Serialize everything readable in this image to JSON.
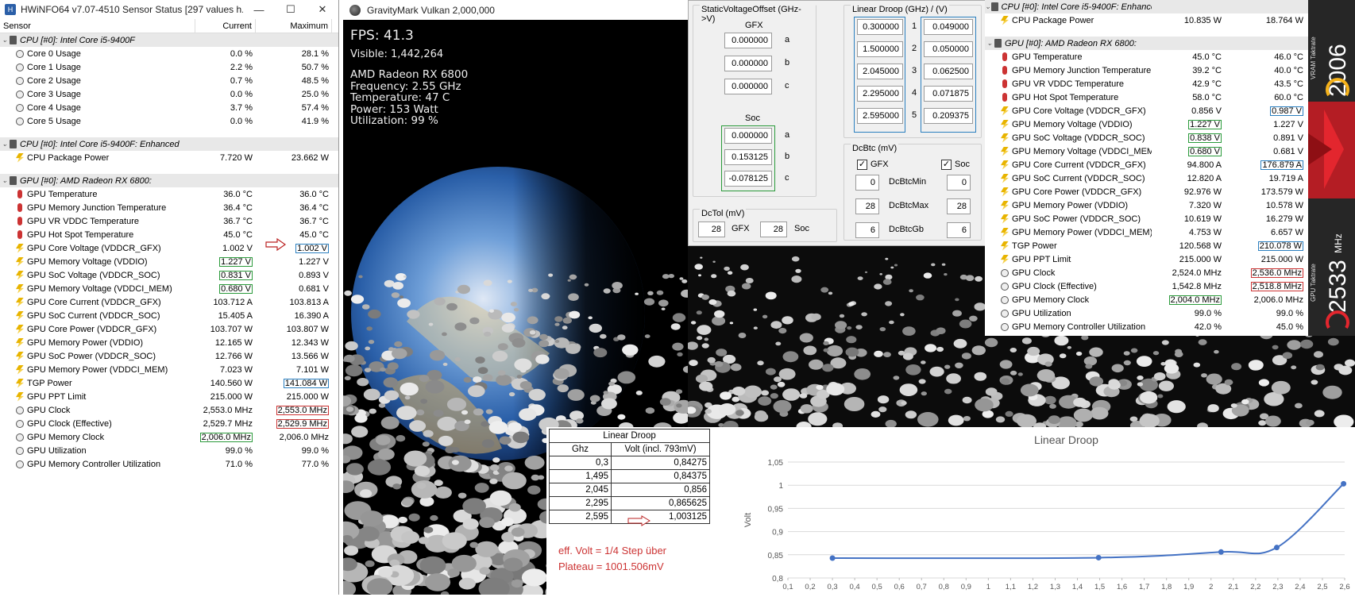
{
  "hwinfo_left": {
    "title": "HWiNFO64 v7.07-4510 Sensor Status [297 values h...",
    "win_buttons": [
      "—",
      "☐",
      "✕"
    ],
    "columns": [
      "Sensor",
      "Current",
      "Maximum"
    ],
    "groups": [
      {
        "title": "CPU [#0]: Intel Core i5-9400F",
        "rows": [
          {
            "icon": "clock",
            "name": "Core 0 Usage",
            "current": "0.0 %",
            "max": "28.1 %"
          },
          {
            "icon": "clock",
            "name": "Core 1 Usage",
            "current": "2.2 %",
            "max": "50.7 %"
          },
          {
            "icon": "clock",
            "name": "Core 2 Usage",
            "current": "0.7 %",
            "max": "48.5 %"
          },
          {
            "icon": "clock",
            "name": "Core 3 Usage",
            "current": "0.0 %",
            "max": "25.0 %"
          },
          {
            "icon": "clock",
            "name": "Core 4 Usage",
            "current": "3.7 %",
            "max": "57.4 %"
          },
          {
            "icon": "clock",
            "name": "Core 5 Usage",
            "current": "0.0 %",
            "max": "41.9 %"
          }
        ]
      },
      {
        "title": "CPU [#0]: Intel Core i5-9400F: Enhanced",
        "rows": [
          {
            "icon": "bolt",
            "name": "CPU Package Power",
            "current": "7.720 W",
            "max": "23.662 W"
          }
        ]
      },
      {
        "title": "GPU [#0]: AMD Radeon RX 6800:",
        "rows": [
          {
            "icon": "therm",
            "name": "GPU Temperature",
            "current": "36.0 °C",
            "max": "36.0 °C"
          },
          {
            "icon": "therm",
            "name": "GPU Memory Junction Temperature",
            "current": "36.4 °C",
            "max": "36.4 °C"
          },
          {
            "icon": "therm",
            "name": "GPU VR VDDC Temperature",
            "current": "36.7 °C",
            "max": "36.7 °C"
          },
          {
            "icon": "therm",
            "name": "GPU Hot Spot Temperature",
            "current": "45.0 °C",
            "max": "45.0 °C"
          },
          {
            "icon": "bolt",
            "name": "GPU Core Voltage (VDDCR_GFX)",
            "current": "1.002 V",
            "max": "1.002 V",
            "box_max": "blue",
            "arrow": true
          },
          {
            "icon": "bolt",
            "name": "GPU Memory Voltage (VDDIO)",
            "current": "1.227 V",
            "max": "1.227 V",
            "box_cur": "green"
          },
          {
            "icon": "bolt",
            "name": "GPU SoC Voltage (VDDCR_SOC)",
            "current": "0.831 V",
            "max": "0.893 V",
            "box_cur": "green"
          },
          {
            "icon": "bolt",
            "name": "GPU Memory Voltage (VDDCI_MEM)",
            "current": "0.680 V",
            "max": "0.681 V",
            "box_cur": "green"
          },
          {
            "icon": "bolt",
            "name": "GPU Core Current (VDDCR_GFX)",
            "current": "103.712 A",
            "max": "103.813 A"
          },
          {
            "icon": "bolt",
            "name": "GPU SoC Current (VDDCR_SOC)",
            "current": "15.405 A",
            "max": "16.390 A"
          },
          {
            "icon": "bolt",
            "name": "GPU Core Power (VDDCR_GFX)",
            "current": "103.707 W",
            "max": "103.807 W"
          },
          {
            "icon": "bolt",
            "name": "GPU Memory Power (VDDIO)",
            "current": "12.165 W",
            "max": "12.343 W"
          },
          {
            "icon": "bolt",
            "name": "GPU SoC Power (VDDCR_SOC)",
            "current": "12.766 W",
            "max": "13.566 W"
          },
          {
            "icon": "bolt",
            "name": "GPU Memory Power (VDDCI_MEM)",
            "current": "7.023 W",
            "max": "7.101 W"
          },
          {
            "icon": "bolt",
            "name": "TGP Power",
            "current": "140.560 W",
            "max": "141.084 W",
            "box_max": "blue"
          },
          {
            "icon": "bolt",
            "name": "GPU PPT Limit",
            "current": "215.000 W",
            "max": "215.000 W"
          },
          {
            "icon": "clock",
            "name": "GPU Clock",
            "current": "2,553.0 MHz",
            "max": "2,553.0 MHz",
            "box_max": "red"
          },
          {
            "icon": "clock",
            "name": "GPU Clock (Effective)",
            "current": "2,529.7 MHz",
            "max": "2,529.9 MHz",
            "box_max": "red"
          },
          {
            "icon": "clock",
            "name": "GPU Memory Clock",
            "current": "2,006.0 MHz",
            "max": "2,006.0 MHz",
            "box_cur": "green"
          },
          {
            "icon": "clock",
            "name": "GPU Utilization",
            "current": "99.0 %",
            "max": "99.0 %"
          },
          {
            "icon": "clock",
            "name": "GPU Memory Controller Utilization",
            "current": "71.0 %",
            "max": "77.0 %"
          }
        ]
      }
    ]
  },
  "gravitymark": {
    "title": "GravityMark Vulkan 2,000,000",
    "fps": "FPS: 41.3",
    "visible": "Visible: 1,442,264",
    "gpu": "AMD Radeon RX 6800",
    "frequency": "Frequency: 2.55 GHz",
    "temperature": "Temperature: 47 C",
    "power": "Power: 153 Watt",
    "utilization": "Utilization: 99 %"
  },
  "voltage_editor": {
    "static_offset_label": "StaticVoltageOffset (GHz->V)",
    "gfx_label": "GFX",
    "gfx": [
      {
        "v": "0.000000",
        "k": "a"
      },
      {
        "v": "0.000000",
        "k": "b"
      },
      {
        "v": "0.000000",
        "k": "c"
      }
    ],
    "soc_label": "Soc",
    "soc": [
      {
        "v": "0.000000",
        "k": "a"
      },
      {
        "v": "0.153125",
        "k": "b"
      },
      {
        "v": "-0.078125",
        "k": "c"
      }
    ],
    "linear_droop_label": "Linear Droop (GHz) / (V)",
    "droop": [
      {
        "ghz": "0.300000",
        "n": "1",
        "v": "0.049000"
      },
      {
        "ghz": "1.500000",
        "n": "2",
        "v": "0.050000"
      },
      {
        "ghz": "2.045000",
        "n": "3",
        "v": "0.062500"
      },
      {
        "ghz": "2.295000",
        "n": "4",
        "v": "0.071875"
      },
      {
        "ghz": "2.595000",
        "n": "5",
        "v": "0.209375"
      }
    ],
    "dcbtc_label": "DcBtc (mV)",
    "dcbtc_gfx": "GFX",
    "dcbtc_soc": "Soc",
    "dcbtc_rows": [
      {
        "l": "0",
        "name": "DcBtcMin",
        "r": "0"
      },
      {
        "l": "28",
        "name": "DcBtcMax",
        "r": "28"
      },
      {
        "l": "6",
        "name": "DcBtcGb",
        "r": "6"
      }
    ],
    "dctol_label": "DcTol (mV)",
    "dctol_gfx_val": "28",
    "dctol_gfx": "GFX",
    "dctol_soc_val": "28",
    "dctol_soc": "Soc"
  },
  "hwinfo_right": {
    "groups": [
      {
        "title": "CPU [#0]: Intel Core i5-9400F: Enhanced",
        "rows": [
          {
            "icon": "bolt",
            "name": "CPU Package Power",
            "current": "10.835 W",
            "max": "18.764 W"
          }
        ]
      },
      {
        "title": "GPU [#0]: AMD Radeon RX 6800:",
        "rows": [
          {
            "icon": "therm",
            "name": "GPU Temperature",
            "current": "45.0 °C",
            "max": "46.0 °C"
          },
          {
            "icon": "therm",
            "name": "GPU Memory Junction Temperature",
            "current": "39.2 °C",
            "max": "40.0 °C"
          },
          {
            "icon": "therm",
            "name": "GPU VR VDDC Temperature",
            "current": "42.9 °C",
            "max": "43.5 °C"
          },
          {
            "icon": "therm",
            "name": "GPU Hot Spot Temperature",
            "current": "58.0 °C",
            "max": "60.0 °C"
          },
          {
            "icon": "bolt",
            "name": "GPU Core Voltage (VDDCR_GFX)",
            "current": "0.856 V",
            "max": "0.987 V",
            "box_max": "blue"
          },
          {
            "icon": "bolt",
            "name": "GPU Memory Voltage (VDDIO)",
            "current": "1.227 V",
            "max": "1.227 V",
            "box_cur": "green"
          },
          {
            "icon": "bolt",
            "name": "GPU SoC Voltage (VDDCR_SOC)",
            "current": "0.838 V",
            "max": "0.891 V",
            "box_cur": "green"
          },
          {
            "icon": "bolt",
            "name": "GPU Memory Voltage (VDDCI_MEM)",
            "current": "0.680 V",
            "max": "0.681 V",
            "box_cur": "green"
          },
          {
            "icon": "bolt",
            "name": "GPU Core Current (VDDCR_GFX)",
            "current": "94.800 A",
            "max": "176.879 A",
            "box_max": "blue"
          },
          {
            "icon": "bolt",
            "name": "GPU SoC Current (VDDCR_SOC)",
            "current": "12.820 A",
            "max": "19.719 A"
          },
          {
            "icon": "bolt",
            "name": "GPU Core Power (VDDCR_GFX)",
            "current": "92.976 W",
            "max": "173.579 W"
          },
          {
            "icon": "bolt",
            "name": "GPU Memory Power (VDDIO)",
            "current": "7.320 W",
            "max": "10.578 W"
          },
          {
            "icon": "bolt",
            "name": "GPU SoC Power (VDDCR_SOC)",
            "current": "10.619 W",
            "max": "16.279 W"
          },
          {
            "icon": "bolt",
            "name": "GPU Memory Power (VDDCI_MEM)",
            "current": "4.753 W",
            "max": "6.657 W"
          },
          {
            "icon": "bolt",
            "name": "TGP Power",
            "current": "120.568 W",
            "max": "210.078 W",
            "box_max": "blue"
          },
          {
            "icon": "bolt",
            "name": "GPU PPT Limit",
            "current": "215.000 W",
            "max": "215.000 W"
          },
          {
            "icon": "clock",
            "name": "GPU Clock",
            "current": "2,524.0 MHz",
            "max": "2,536.0 MHz",
            "box_max": "red"
          },
          {
            "icon": "clock",
            "name": "GPU Clock (Effective)",
            "current": "1,542.8 MHz",
            "max": "2,518.8 MHz",
            "box_max": "red"
          },
          {
            "icon": "clock",
            "name": "GPU Memory Clock",
            "current": "2,004.0 MHz",
            "max": "2,006.0 MHz",
            "box_cur": "green"
          },
          {
            "icon": "clock",
            "name": "GPU Utilization",
            "current": "99.0 %",
            "max": "99.0 %"
          },
          {
            "icon": "clock",
            "name": "GPU Memory Controller Utilization",
            "current": "42.0 %",
            "max": "45.0 %"
          }
        ]
      }
    ]
  },
  "side_strip": {
    "vram_value": "2006",
    "vram_label": "VRAM Taktrate",
    "gpu_value": "2533",
    "gpu_unit": "MHz",
    "gpu_label": "GPU Taktrate",
    "accent": "#f5b21a",
    "red": "#e3262e"
  },
  "droop_table": {
    "title": "Linear Droop",
    "headers": [
      "Ghz",
      "Volt (incl. 793mV)"
    ],
    "rows": [
      [
        "0,3",
        "0,84275"
      ],
      [
        "1,495",
        "0,84375"
      ],
      [
        "2,045",
        "0,856"
      ],
      [
        "2,295",
        "0,865625"
      ],
      [
        "2,595",
        "1,003125"
      ]
    ],
    "note1": "eff. Volt = 1/4 Step über",
    "note2": "Plateau = 1001.506mV"
  },
  "chart_data": {
    "type": "line",
    "title": "Linear Droop",
    "ylabel": "Volt",
    "xlabel": "",
    "x": [
      0.3,
      1.495,
      2.045,
      2.295,
      2.595
    ],
    "series": [
      {
        "values": [
          0.84275,
          0.84375,
          0.856,
          0.865625,
          1.003125
        ]
      }
    ],
    "xlim": [
      0.1,
      2.6
    ],
    "ylim": [
      0.8,
      1.05
    ],
    "xticks": [
      "0,1",
      "0,2",
      "0,3",
      "0,4",
      "0,5",
      "0,6",
      "0,7",
      "0,8",
      "0,9",
      "1",
      "1,1",
      "1,2",
      "1,3",
      "1,4",
      "1,5",
      "1,6",
      "1,7",
      "1,8",
      "1,9",
      "2",
      "2,1",
      "2,2",
      "2,3",
      "2,4",
      "2,5",
      "2,6"
    ],
    "yticks": [
      "0,8",
      "0,85",
      "0,9",
      "0,95",
      "1",
      "1,05"
    ],
    "color": "#4472c4",
    "grid": true
  }
}
